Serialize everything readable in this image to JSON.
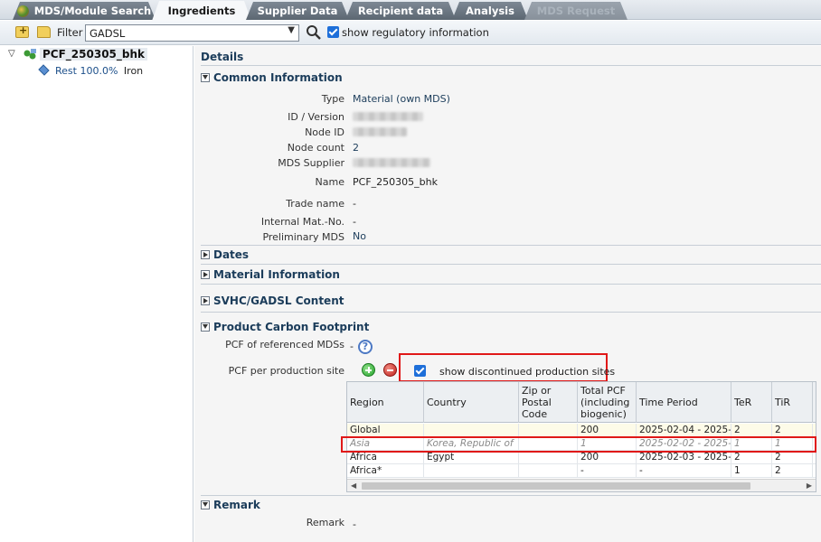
{
  "tabs": [
    {
      "label": "MDS/Module Search",
      "state": "normal"
    },
    {
      "label": "Ingredients",
      "state": "active"
    },
    {
      "label": "Supplier Data",
      "state": "normal"
    },
    {
      "label": "Recipient data",
      "state": "normal"
    },
    {
      "label": "Analysis",
      "state": "normal"
    },
    {
      "label": "MDS Request",
      "state": "disabled"
    }
  ],
  "toolbar": {
    "filter_label": "Filter",
    "filter_value": "GADSL",
    "show_regulatory_label": "show regulatory information",
    "show_regulatory_checked": true
  },
  "tree": {
    "root_label": "PCF_250305_bhk",
    "leaf_label": "Rest",
    "leaf_percent": "100.0%",
    "leaf_material": "Iron"
  },
  "details": {
    "title": "Details",
    "common_information": {
      "header": "Common Information",
      "type_label": "Type",
      "type_value": "Material (own MDS)",
      "id_version_label": "ID / Version",
      "node_id_label": "Node ID",
      "node_count_label": "Node count",
      "node_count_value": "2",
      "mds_supplier_label": "MDS Supplier",
      "name_label": "Name",
      "name_value": "PCF_250305_bhk",
      "trade_name_label": "Trade name",
      "trade_name_value": "-",
      "internal_mat_label": "Internal Mat.-No.",
      "internal_mat_value": "-",
      "preliminary_label": "Preliminary MDS",
      "preliminary_value": "No"
    },
    "dates_header": "Dates",
    "material_info_header": "Material Information",
    "svhc_header": "SVHC/GADSL Content",
    "pcf": {
      "header": "Product Carbon Footprint",
      "referenced_label": "PCF of referenced MDSs",
      "referenced_value": "-",
      "per_site_label": "PCF per production site",
      "show_discontinued_label": "show discontinued production sites",
      "show_discontinued_checked": true,
      "columns": [
        "Region",
        "Country",
        "Zip or Postal Code",
        "Total PCF (including biogenic)",
        "Time Period",
        "TeR",
        "TiR"
      ],
      "rows": [
        {
          "region": "Global",
          "country": "",
          "zip": "",
          "total_pcf": "200",
          "time_period": "2025-02-04 - 2025-0...",
          "ter": "2",
          "tir": "2",
          "discontinued": false
        },
        {
          "region": "Asia",
          "country": "Korea, Republic of",
          "zip": "",
          "total_pcf": "1",
          "time_period": "2025-02-02 - 2025-0...",
          "ter": "1",
          "tir": "1",
          "discontinued": true
        },
        {
          "region": "Africa",
          "country": "Egypt",
          "zip": "",
          "total_pcf": "200",
          "time_period": "2025-02-03 - 2025-0...",
          "ter": "2",
          "tir": "2",
          "discontinued": false
        },
        {
          "region": "Africa*",
          "country": "",
          "zip": "",
          "total_pcf": "-",
          "time_period": "-",
          "ter": "1",
          "tir": "2",
          "discontinued": false
        }
      ]
    },
    "remark": {
      "header": "Remark",
      "label": "Remark",
      "value": "-"
    }
  },
  "colors": {
    "section_header": "#1b3c5a",
    "highlight_border": "#e01818",
    "checkbox": "#1e6fd9"
  }
}
